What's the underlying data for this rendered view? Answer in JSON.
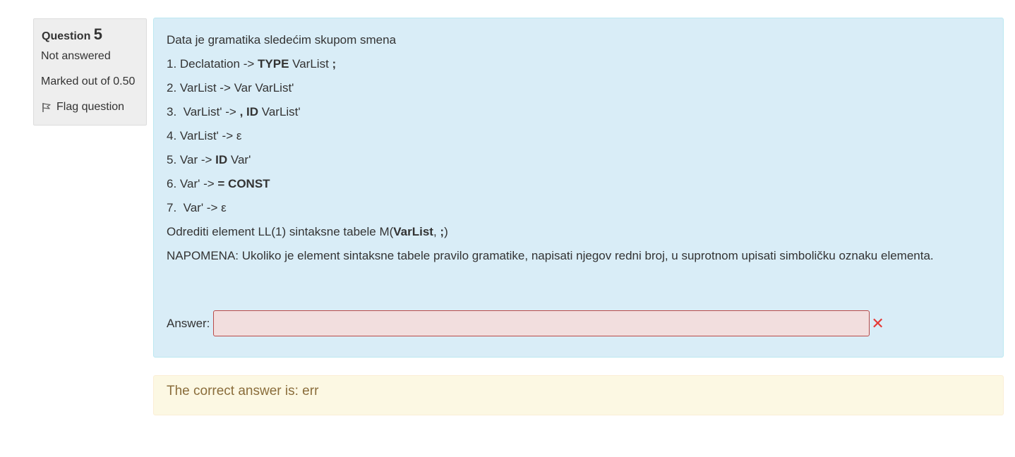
{
  "info": {
    "question_word": "Question",
    "question_number": "5",
    "state": "Not answered",
    "grade": "Marked out of 0.50",
    "flag_label": "Flag question"
  },
  "question": {
    "intro": "Data je gramatika sledećim skupom smena",
    "rules": [
      {
        "num": "1. ",
        "left": "Declatation",
        "arrow": " -> ",
        "parts": [
          [
            "b",
            "TYPE"
          ],
          [
            "t",
            " VarList "
          ],
          [
            "b",
            ";"
          ]
        ]
      },
      {
        "num": "2. ",
        "left": "VarList",
        "arrow": " -> ",
        "parts": [
          [
            "t",
            "Var VarList'"
          ]
        ]
      },
      {
        "num": "3.  ",
        "left": "VarList'",
        "arrow": " -> ",
        "parts": [
          [
            "b",
            ", ID"
          ],
          [
            "t",
            " VarList'"
          ]
        ]
      },
      {
        "num": "4. ",
        "left": "VarList'",
        "arrow": " -> ",
        "parts": [
          [
            "t",
            "ε"
          ]
        ]
      },
      {
        "num": "5. ",
        "left": "Var",
        "arrow": " -> ",
        "parts": [
          [
            "b",
            "ID"
          ],
          [
            "t",
            " Var'"
          ]
        ]
      },
      {
        "num": "6. ",
        "left": "Var'",
        "arrow": " -> ",
        "parts": [
          [
            "b",
            "= CONST"
          ]
        ]
      },
      {
        "num": "7.  ",
        "left": "Var'",
        "arrow": " -> ",
        "parts": [
          [
            "t",
            "ε"
          ]
        ]
      }
    ],
    "task_prefix": "Odrediti element LL(1) sintaksne tabele M(",
    "task_arg1": "VarList",
    "task_sep": ", ",
    "task_arg2": ";",
    "task_suffix": ")",
    "note": "NAPOMENA: Ukoliko je element sintaksne tabele pravilo gramatike, napisati njegov redni broj, u suprotnom upisati simboličku oznaku elementa.",
    "answer_label": "Answer:",
    "answer_value": "",
    "answer_icon": "incorrect-x-icon"
  },
  "feedback": {
    "correct_answer_text": "The correct answer is: err"
  },
  "colors": {
    "formulation_bg": "#d9edf7",
    "answer_incorrect_bg": "#f2dede",
    "feedback_bg": "#fcf8e3",
    "incorrect_icon": "#e53935"
  }
}
